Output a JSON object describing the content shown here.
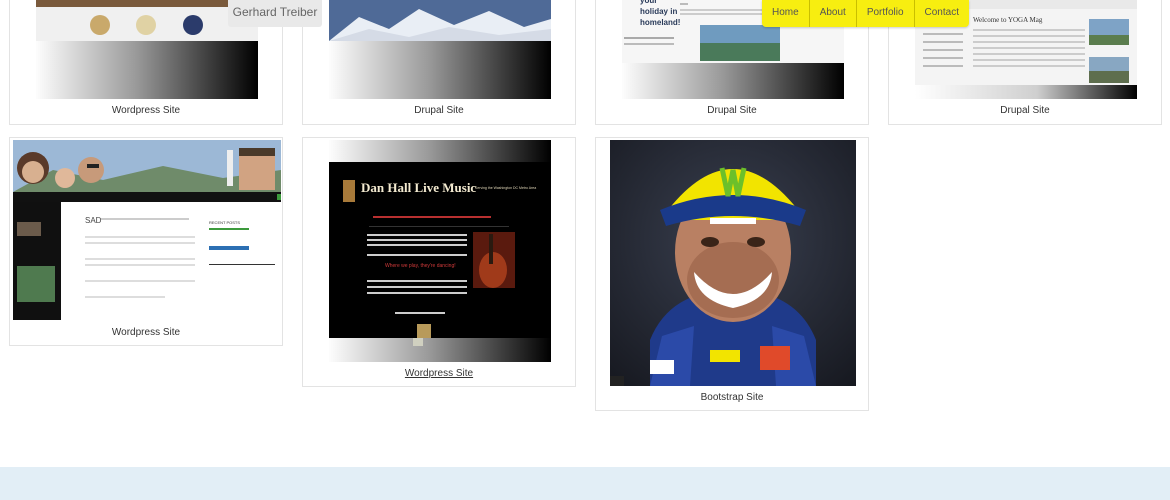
{
  "header": {
    "brand": "Gerhard Treiber",
    "nav": [
      "Home",
      "About",
      "Portfolio",
      "Contact"
    ]
  },
  "thumbnail_text": {
    "holiday": "your holiday in homeland!",
    "yoga_title": "Welcome to YOGA Mag",
    "dan_hall_title": "Dan Hall Live Music",
    "dan_hall_tagline": "Serving the Washington DC Metro Area",
    "sad_title": "SAD",
    "recent_posts": "RECENT POSTS",
    "where_we_play": "Where we play, they're dancing!"
  },
  "portfolio": {
    "items": [
      {
        "caption": "Wordpress Site"
      },
      {
        "caption": "Drupal Site"
      },
      {
        "caption": "Drupal Site"
      },
      {
        "caption": "Drupal Site"
      },
      {
        "caption": "Wordpress Site"
      },
      {
        "caption": "Wordpress Site"
      },
      {
        "caption": "Bootstrap Site"
      }
    ]
  },
  "colors": {
    "navbar_bg": "#f7ee10",
    "footer_band": "#e2eef6",
    "card_border": "#e3e3e3"
  }
}
